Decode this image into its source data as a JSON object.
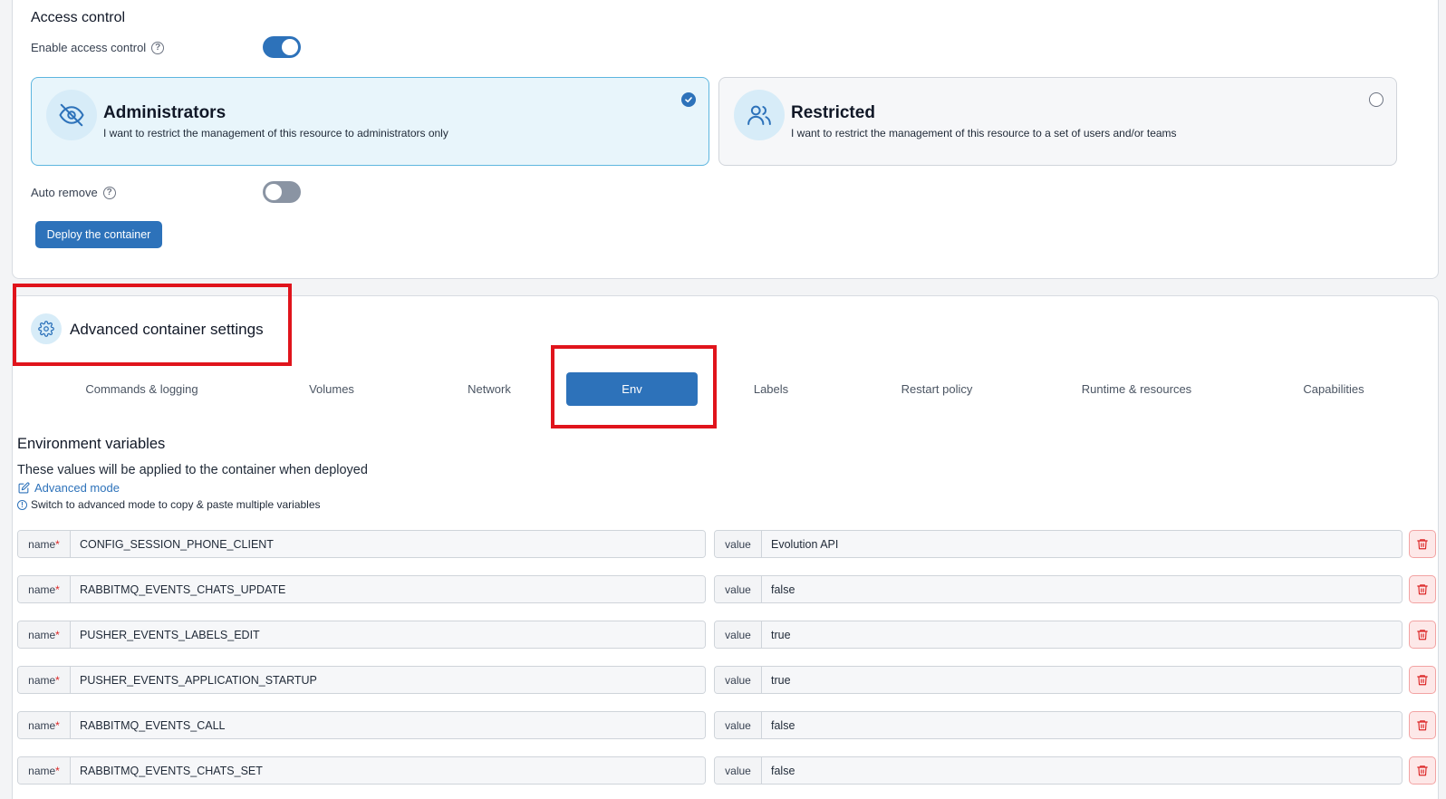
{
  "access_control": {
    "title": "Access control",
    "enable_label": "Enable access control",
    "enabled": true,
    "options": [
      {
        "title": "Administrators",
        "description": "I want to restrict the management of this resource to administrators only",
        "selected": true,
        "icon": "eye-off-icon"
      },
      {
        "title": "Restricted",
        "description": "I want to restrict the management of this resource to a set of users and/or teams",
        "selected": false,
        "icon": "users-icon"
      }
    ],
    "auto_remove_label": "Auto remove",
    "auto_remove": false,
    "deploy_button": "Deploy the container"
  },
  "advanced": {
    "title": "Advanced container settings",
    "icon": "gear-icon",
    "tabs": [
      "Commands & logging",
      "Volumes",
      "Network",
      "Env",
      "Labels",
      "Restart policy",
      "Runtime & resources",
      "Capabilities"
    ],
    "active_tab": "Env"
  },
  "env": {
    "title": "Environment variables",
    "description": "These values will be applied to the container when deployed",
    "advanced_mode": "Advanced mode",
    "advanced_hint": "Switch to advanced mode to copy & paste multiple variables",
    "name_label": "name",
    "value_label": "value",
    "required_mark": "*",
    "variables": [
      {
        "name": "CONFIG_SESSION_PHONE_CLIENT",
        "value": "Evolution API"
      },
      {
        "name": "RABBITMQ_EVENTS_CHATS_UPDATE",
        "value": "false"
      },
      {
        "name": "PUSHER_EVENTS_LABELS_EDIT",
        "value": "true"
      },
      {
        "name": "PUSHER_EVENTS_APPLICATION_STARTUP",
        "value": "true"
      },
      {
        "name": "RABBITMQ_EVENTS_CALL",
        "value": "false"
      },
      {
        "name": "RABBITMQ_EVENTS_CHATS_SET",
        "value": "false"
      }
    ]
  },
  "colors": {
    "primary": "#2d72ba",
    "highlight": "#e0141c",
    "danger": "#dc2626"
  }
}
